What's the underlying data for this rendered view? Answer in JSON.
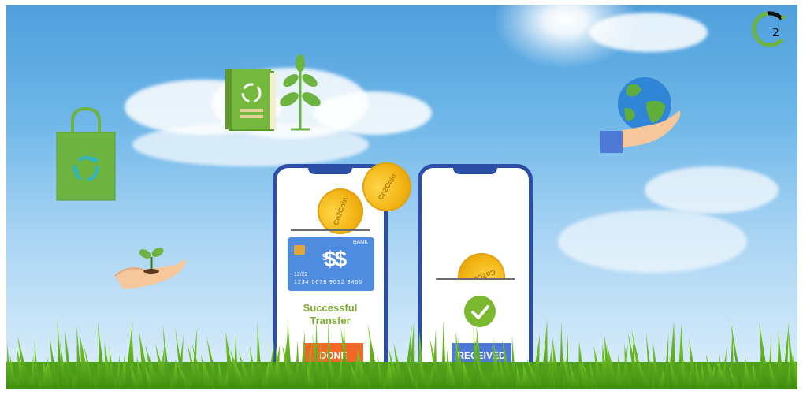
{
  "scene": {
    "phone_left": {
      "card": {
        "bank_label": "BANK",
        "symbol": "$$",
        "small_symbol": "$",
        "expiry": "12/22",
        "number": "1234  5678  9012  3456"
      },
      "message_line1": "Successful",
      "message_line2": "Transfer",
      "button_label": "DONE",
      "coin_label": "Co2Coin"
    },
    "phone_right": {
      "button_label": "RECEIVED",
      "coin_label": "Co2Coin"
    },
    "flying_coin_label": "Co2Coin",
    "logo_subscript": "2"
  },
  "colors": {
    "phone_border": "#2c4ea6",
    "done_button": "#f3682a",
    "received_button": "#4f79d6",
    "success_text": "#7cab2d",
    "check_green": "#7ab82f",
    "coin_gold": "#f2b413",
    "eco_green": "#6db33f"
  },
  "icons": [
    "recycle-bag-icon",
    "recycle-book-icon",
    "sprout-icon",
    "hand-sprout-icon",
    "hand-globe-icon",
    "co2-logo-icon",
    "checkmark-icon",
    "coin-icon"
  ]
}
